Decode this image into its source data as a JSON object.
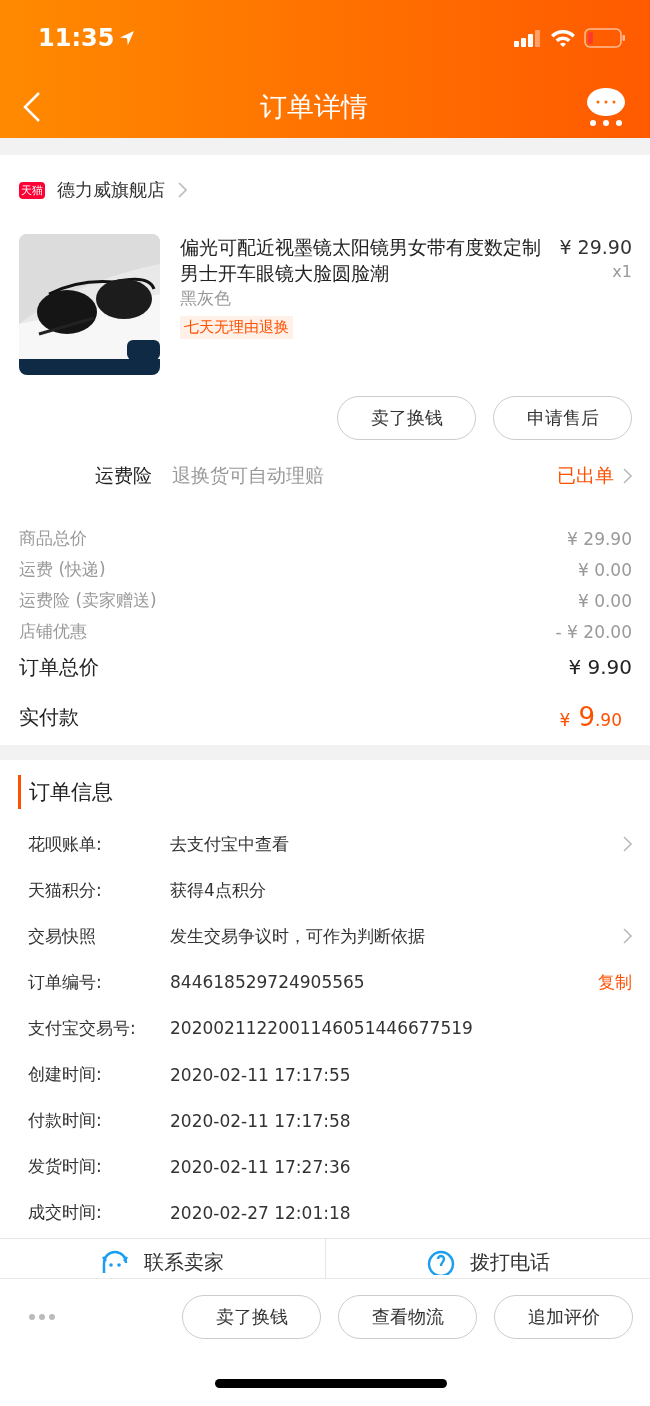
{
  "status_bar": {
    "time": "11:35"
  },
  "nav": {
    "title": "订单详情"
  },
  "shop": {
    "badge": "天猫",
    "name": "德力威旗舰店"
  },
  "product": {
    "title": "偏光可配近视墨镜太阳镜男女带有度数定制男士开车眼镜大脸圆脸潮",
    "price": "¥ 29.90",
    "quantity": "x1",
    "variant": "黑灰色",
    "tag": "七天无理由退换"
  },
  "item_buttons": [
    "卖了换钱",
    "申请售后"
  ],
  "insurance": {
    "label": "运费险",
    "description": "退换货可自动理赔",
    "status": "已出单"
  },
  "costs": [
    {
      "label": "商品总价",
      "value": "¥ 29.90"
    },
    {
      "label": "运费 (快递)",
      "value": "¥ 0.00"
    },
    {
      "label": "运费险 (卖家赠送)",
      "value": "¥ 0.00"
    },
    {
      "label": "店铺优惠",
      "value": "- ¥ 20.00"
    }
  ],
  "order_total": {
    "label": "订单总价",
    "value": "¥ 9.90"
  },
  "paid": {
    "label": "实付款",
    "currency": "¥",
    "integer": "9",
    "decimal": ".90"
  },
  "order_info": {
    "title": "订单信息",
    "rows": [
      {
        "label": "花呗账单:",
        "value": "去支付宝中查看",
        "kind": "chevron"
      },
      {
        "label": "天猫积分:",
        "value": "获得4点积分",
        "kind": "plain"
      },
      {
        "label": "交易快照",
        "value": "发生交易争议时，可作为判断依据",
        "kind": "chevron"
      },
      {
        "label": "订单编号:",
        "value": "844618529724905565",
        "kind": "link",
        "action": "复制"
      },
      {
        "label": "支付宝交易号:",
        "value": "2020021122001146051446677519",
        "kind": "plain"
      },
      {
        "label": "创建时间:",
        "value": "2020-02-11 17:17:55",
        "kind": "plain"
      },
      {
        "label": "付款时间:",
        "value": "2020-02-11 17:17:58",
        "kind": "plain"
      },
      {
        "label": "发货时间:",
        "value": "2020-02-11 17:27:36",
        "kind": "plain"
      },
      {
        "label": "成交时间:",
        "value": "2020-02-27 12:01:18",
        "kind": "plain"
      }
    ]
  },
  "contact": [
    {
      "label": "联系卖家",
      "kind": "chat"
    },
    {
      "label": "拨打电话",
      "kind": "phone"
    }
  ],
  "bottom_buttons": [
    "卖了换钱",
    "查看物流",
    "追加评价"
  ]
}
